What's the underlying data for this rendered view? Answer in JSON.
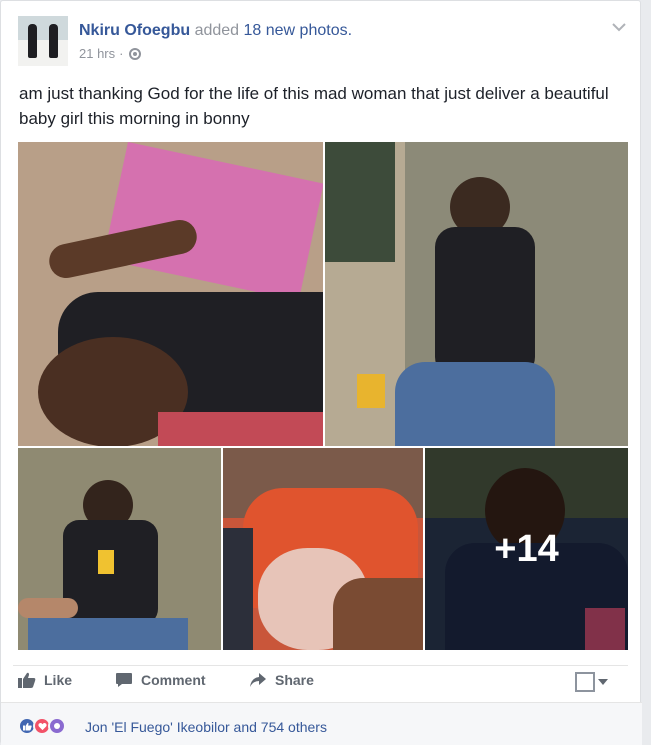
{
  "post": {
    "author": "Nkiru Ofoegbu",
    "action_text": "added",
    "action_link": "18 new photos.",
    "timestamp": "21 hrs",
    "separator": "·",
    "privacy_icon": "globe-icon",
    "menu_icon": "chevron-down-icon",
    "text": "am just thanking God for the life of this mad woman that just deliver a beautiful baby girl this morning in bonny"
  },
  "photos": {
    "count_shown": 5,
    "more_label": "+14"
  },
  "actions": {
    "like_label": "Like",
    "comment_label": "Comment",
    "share_label": "Share"
  },
  "reactions": {
    "icons": [
      "like-reaction-icon",
      "love-reaction-icon",
      "purple-reaction-icon"
    ],
    "summary": "Jon 'El Fuego' Ikeobilor and 754 others"
  },
  "colors": {
    "link": "#365899",
    "muted": "#90949c",
    "like_blue": "#4267b2",
    "love_red": "#f25268"
  }
}
